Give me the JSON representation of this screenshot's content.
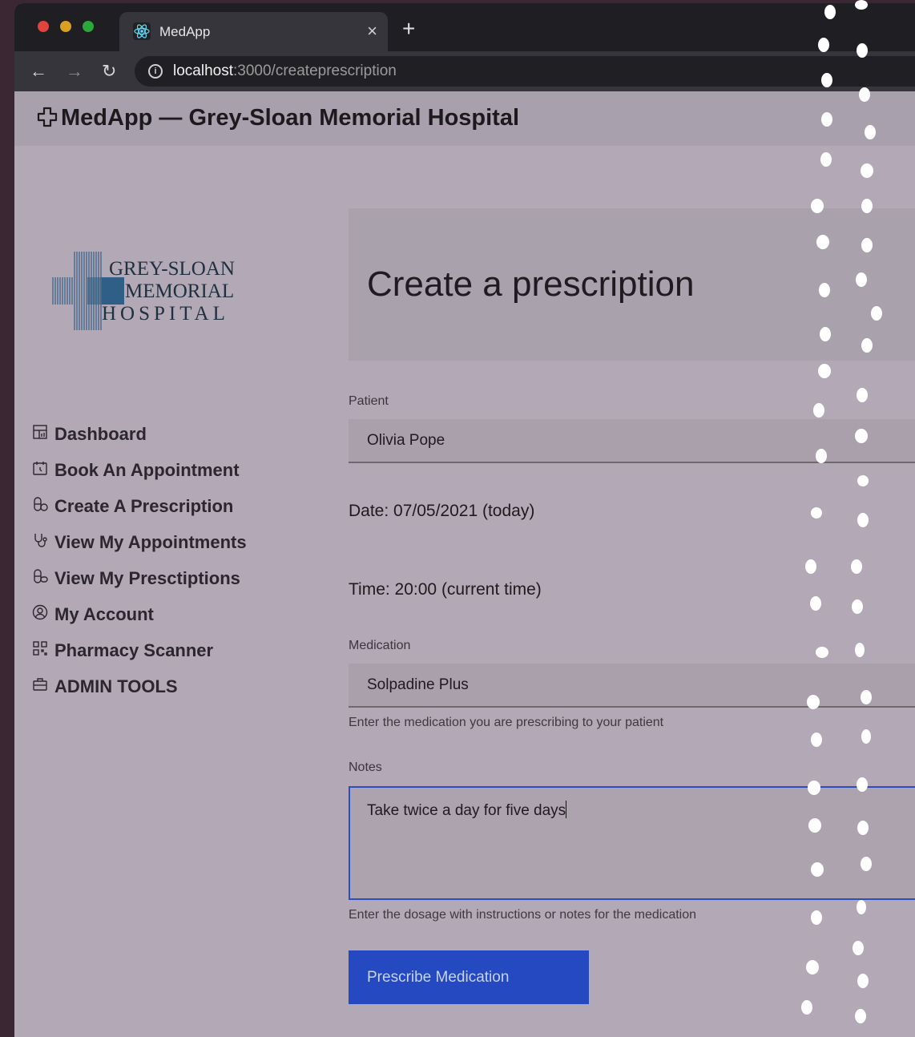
{
  "browser": {
    "tab_title": "MedApp",
    "new_tab_symbol": "+",
    "url_host": "localhost",
    "url_path": ":3000/createprescription"
  },
  "header": {
    "title": "MedApp — Grey-Sloan Memorial Hospital"
  },
  "logo": {
    "line1": "GREY-SLOAN",
    "line2": "MEMORIAL",
    "line3": "HOSPITAL"
  },
  "sidebar": {
    "items": [
      {
        "label": "Dashboard",
        "icon": "dashboard-icon"
      },
      {
        "label": "Book An Appointment",
        "icon": "calendar-icon"
      },
      {
        "label": "Create A Prescription",
        "icon": "pill-icon"
      },
      {
        "label": "View My Appointments",
        "icon": "stethoscope-icon"
      },
      {
        "label": "View My Presctiptions",
        "icon": "pill-icon"
      },
      {
        "label": "My Account",
        "icon": "account-icon"
      },
      {
        "label": "Pharmacy Scanner",
        "icon": "qr-icon"
      },
      {
        "label": "ADMIN TOOLS",
        "icon": "toolbox-icon"
      }
    ]
  },
  "main": {
    "title": "Create a prescription",
    "patient_label": "Patient",
    "patient_value": "Olivia Pope",
    "date_text": "Date: 07/05/2021 (today)",
    "time_text": "Time: 20:00 (current time)",
    "medication_label": "Medication",
    "medication_value": "Solpadine Plus",
    "medication_helper": "Enter the medication you are prescribing to your patient",
    "notes_label": "Notes",
    "notes_value": "Take twice a day for five days",
    "notes_helper": "Enter the dosage with instructions or notes for the medication",
    "submit_label": "Prescribe Medication"
  },
  "colors": {
    "accent": "#2449c0",
    "page_bg": "#b3a8b5",
    "overlay_dots": "#ffffff"
  }
}
